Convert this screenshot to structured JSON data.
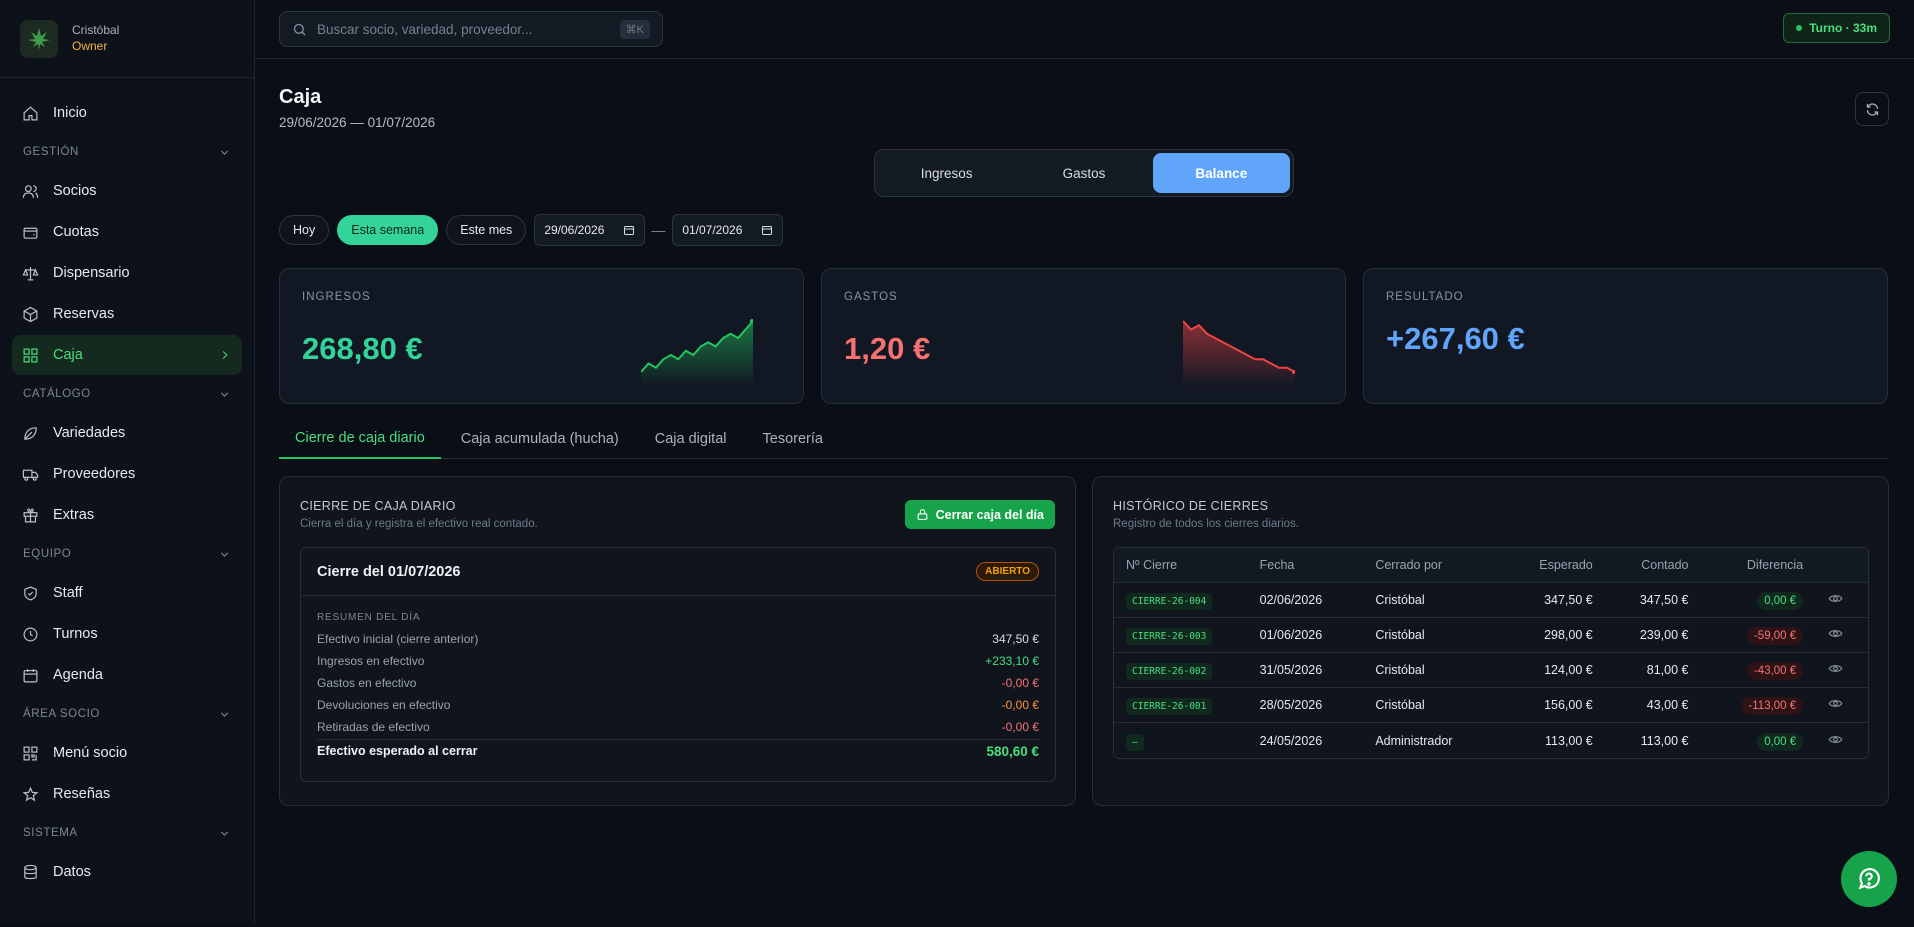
{
  "brand": {
    "name": "Cristóbal",
    "role": "Owner"
  },
  "search": {
    "placeholder": "Buscar socio, variedad, proveedor...",
    "shortcut": "⌘K"
  },
  "turno": "Turno · 33m",
  "sidebar": {
    "inicio": "Inicio",
    "gestion": {
      "label": "GESTIÓN",
      "items": [
        "Socios",
        "Cuotas",
        "Dispensario",
        "Reservas",
        "Caja"
      ]
    },
    "catalogo": {
      "label": "CATÁLOGO",
      "items": [
        "Variedades",
        "Proveedores",
        "Extras"
      ]
    },
    "equipo": {
      "label": "EQUIPO",
      "items": [
        "Staff",
        "Turnos",
        "Agenda"
      ]
    },
    "area_socio": {
      "label": "ÁREA SOCIO",
      "items": [
        "Menú socio",
        "Reseñas"
      ]
    },
    "sistema": {
      "label": "SISTEMA",
      "items": [
        "Datos"
      ]
    },
    "active": "Caja"
  },
  "page": {
    "title": "Caja",
    "range": "29/06/2026 — 01/07/2026"
  },
  "segment": {
    "options": [
      "Ingresos",
      "Gastos",
      "Balance"
    ],
    "active": "Balance"
  },
  "filters": {
    "chips": [
      "Hoy",
      "Esta semana",
      "Este mes"
    ],
    "active": "Esta semana",
    "from": "29/06/2026",
    "to": "01/07/2026"
  },
  "kpis": {
    "ingresos": {
      "label": "INGRESOS",
      "value": "268,80 €",
      "color": "#34d399",
      "spark": [
        3,
        5,
        4,
        6,
        7,
        6,
        8,
        7,
        9,
        10,
        9,
        11,
        12,
        11,
        13,
        15
      ]
    },
    "gastos": {
      "label": "GASTOS",
      "value": "1,20 €",
      "color": "#f87171",
      "spark": [
        15,
        13,
        14,
        12,
        11,
        10,
        9,
        8,
        7,
        6,
        6,
        5,
        4,
        4,
        3
      ]
    },
    "resultado": {
      "label": "RESULTADO",
      "value": "+267,60 €",
      "color": "#60a5fa"
    }
  },
  "tabs": {
    "items": [
      "Cierre de caja diario",
      "Caja acumulada (hucha)",
      "Caja digital",
      "Tesorería"
    ],
    "active": "Cierre de caja diario"
  },
  "cierre": {
    "title": "CIERRE DE CAJA DIARIO",
    "subtitle": "Cierra el día y registra el efectivo real contado.",
    "button": "Cerrar caja del día",
    "card_title": "Cierre del 01/07/2026",
    "badge": "ABIERTO",
    "summary_label": "RESUMEN DEL DÍA",
    "rows": [
      {
        "label": "Efectivo inicial (cierre anterior)",
        "value": "347,50 €"
      },
      {
        "label": "Ingresos en efectivo",
        "value": "+233,10 €"
      },
      {
        "label": "Gastos en efectivo",
        "value": "-0,00 €"
      },
      {
        "label": "Devoluciones en efectivo",
        "value": "-0,00 €"
      },
      {
        "label": "Retiradas de efectivo",
        "value": "-0,00 €"
      }
    ],
    "total_label": "Efectivo esperado al cerrar",
    "total_value": "580,60 €"
  },
  "historico": {
    "title": "HISTÓRICO DE CIERRES",
    "subtitle": "Registro de todos los cierres diarios.",
    "headers": [
      "Nº Cierre",
      "Fecha",
      "Cerrado por",
      "Esperado",
      "Contado",
      "Diferencia"
    ],
    "rows": [
      {
        "id": "CIERRE-26-004",
        "fecha": "02/06/2026",
        "por": "Cristóbal",
        "esperado": "347,50 €",
        "contado": "347,50 €",
        "diferencia": "0,00 €"
      },
      {
        "id": "CIERRE-26-003",
        "fecha": "01/06/2026",
        "por": "Cristóbal",
        "esperado": "298,00 €",
        "contado": "239,00 €",
        "diferencia": "-59,00 €"
      },
      {
        "id": "CIERRE-26-002",
        "fecha": "31/05/2026",
        "por": "Cristóbal",
        "esperado": "124,00 €",
        "contado": "81,00 €",
        "diferencia": "-43,00 €"
      },
      {
        "id": "CIERRE-26-001",
        "fecha": "28/05/2026",
        "por": "Cristóbal",
        "esperado": "156,00 €",
        "contado": "43,00 €",
        "diferencia": "-113,00 €"
      },
      {
        "id": "–",
        "fecha": "24/05/2026",
        "por": "Administrador",
        "esperado": "113,00 €",
        "contado": "113,00 €",
        "diferencia": "0,00 €"
      }
    ]
  }
}
